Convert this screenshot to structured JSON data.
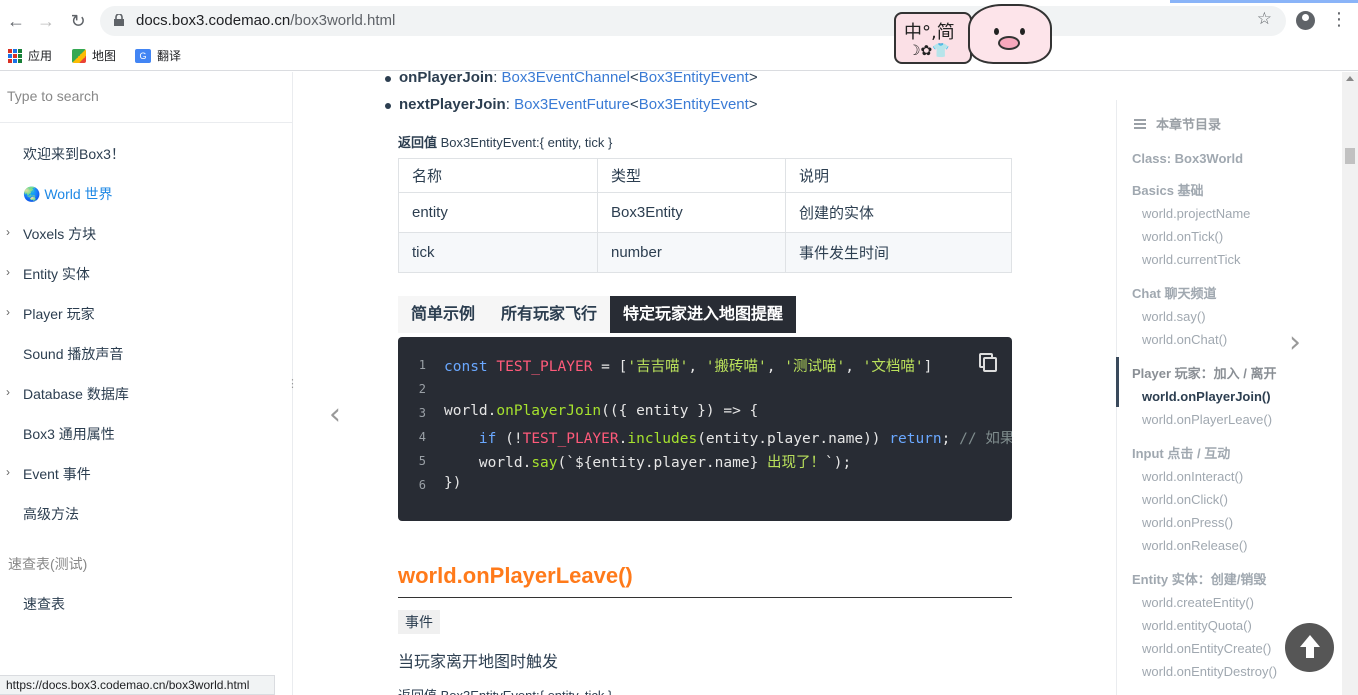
{
  "browser": {
    "url_host": "docs.box3.codemao.cn",
    "url_path": "/box3world.html",
    "status_url": "https://docs.box3.codemao.cn/box3world.html"
  },
  "bookmarks": [
    {
      "label": "应用",
      "icon": "apps-grid-icon"
    },
    {
      "label": "地图",
      "icon": "maps-icon"
    },
    {
      "label": "翻译",
      "icon": "translate-icon"
    }
  ],
  "extension": {
    "text": "中°,简",
    "symbols": "☽✿👕"
  },
  "sidebar": {
    "search_placeholder": "Type to search",
    "items": [
      {
        "label": "欢迎来到Box3！",
        "arrow": false
      },
      {
        "label": "🌏 World 世界",
        "arrow": false,
        "active": true
      },
      {
        "label": "Voxels 方块",
        "arrow": true
      },
      {
        "label": "Entity 实体",
        "arrow": true
      },
      {
        "label": "Player 玩家",
        "arrow": true
      },
      {
        "label": "Sound 播放声音",
        "arrow": false
      },
      {
        "label": "Database 数据库",
        "arrow": true
      },
      {
        "label": "Box3 通用属性",
        "arrow": false
      },
      {
        "label": "Event 事件",
        "arrow": true
      },
      {
        "label": "高级方法",
        "arrow": false
      }
    ],
    "group_label": "速查表(测试)",
    "group_item": "速查表"
  },
  "main": {
    "list": [
      {
        "name": "onPlayerJoin",
        "sep": ": ",
        "t1": "Box3EventChannel",
        "lt": "<",
        "t2": "Box3EntityEvent",
        "gt": ">"
      },
      {
        "name": "nextPlayerJoin",
        "sep": ": ",
        "t1": "Box3EventFuture",
        "lt": "<",
        "t2": "Box3EntityEvent",
        "gt": ">"
      }
    ],
    "return_label": "返回值",
    "return_value": "Box3EntityEvent:{ entity, tick }",
    "table": {
      "headers": [
        "名称",
        "类型",
        "说明"
      ],
      "rows": [
        [
          "entity",
          "Box3Entity",
          "创建的实体"
        ],
        [
          "tick",
          "number",
          "事件发生时间"
        ]
      ]
    },
    "tabs": [
      "简单示例",
      "所有玩家飞行",
      "特定玩家进入地图提醒"
    ],
    "active_tab": 2,
    "code_line_numbers": [
      "1",
      "2",
      "3",
      "4",
      "5",
      "6"
    ],
    "section_title": "world.onPlayerLeave()",
    "section_tag": "事件",
    "section_desc": "当玩家离开地图时触发",
    "section_return": "返回值 Box3EntityEvent:{ entity, tick }"
  },
  "toc": {
    "title": "本章节目录",
    "entries": [
      {
        "type": "h",
        "label": "Class: Box3World"
      },
      {
        "type": "h",
        "label": "Basics 基础"
      },
      {
        "type": "i",
        "label": "world.projectName"
      },
      {
        "type": "i",
        "label": "world.onTick()"
      },
      {
        "type": "i",
        "label": "world.currentTick"
      },
      {
        "type": "h",
        "label": "Chat 聊天频道"
      },
      {
        "type": "i",
        "label": "world.say()"
      },
      {
        "type": "i",
        "label": "world.onChat()"
      },
      {
        "type": "h",
        "label": "Player 玩家：加入 / 离开"
      },
      {
        "type": "i",
        "label": "world.onPlayerJoin()",
        "active": true
      },
      {
        "type": "i",
        "label": "world.onPlayerLeave()"
      },
      {
        "type": "h",
        "label": "Input 点击 / 互动"
      },
      {
        "type": "i",
        "label": "world.onInteract()"
      },
      {
        "type": "i",
        "label": "world.onClick()"
      },
      {
        "type": "i",
        "label": "world.onPress()"
      },
      {
        "type": "i",
        "label": "world.onRelease()"
      },
      {
        "type": "h",
        "label": "Entity 实体：创建/销毁"
      },
      {
        "type": "i",
        "label": "world.createEntity()"
      },
      {
        "type": "i",
        "label": "world.entityQuota()"
      },
      {
        "type": "i",
        "label": "world.onEntityCreate()"
      },
      {
        "type": "i",
        "label": "world.onEntityDestroy()"
      }
    ]
  },
  "colors": {
    "accent": "#ff7a1a",
    "link": "#3a7bd5",
    "code_bg": "#282c34"
  }
}
